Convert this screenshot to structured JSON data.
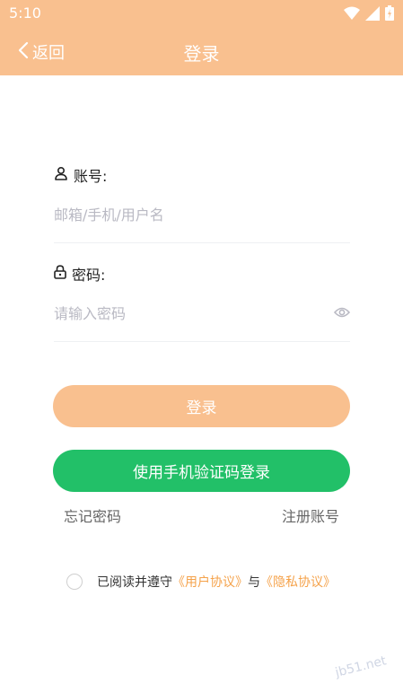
{
  "status_bar": {
    "time": "5:10",
    "icons": [
      "wifi-icon",
      "signal-icon",
      "battery-icon"
    ]
  },
  "header": {
    "back_label": "返回",
    "title": "登录",
    "bg_color": "#f9c08f"
  },
  "form": {
    "account": {
      "label": "账号:",
      "placeholder": "邮箱/手机/用户名",
      "value": ""
    },
    "password": {
      "label": "密码:",
      "placeholder": "请输入密码",
      "value": ""
    }
  },
  "buttons": {
    "login_label": "登录",
    "sms_login_label": "使用手机验证码登录",
    "login_color": "#f9c08f",
    "sms_color": "#22c068"
  },
  "links": {
    "forgot_password": "忘记密码",
    "register": "注册账号"
  },
  "agreement": {
    "prefix": "已阅读并遵守",
    "user_agreement": "《用户协议》",
    "connector": "与",
    "privacy_policy": "《隐私协议》",
    "accent_color": "#f5a24a"
  },
  "watermark": "jb51.net"
}
